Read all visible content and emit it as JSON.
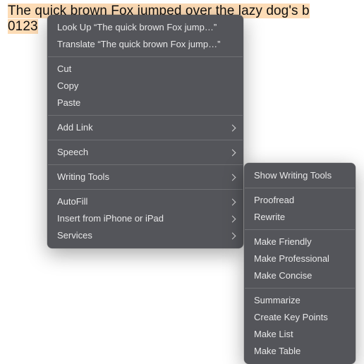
{
  "text": {
    "line1": "The quick brown Fox jumped over the lazy dog's b",
    "line2": "0123"
  },
  "menu_main": {
    "lookup": "Look Up “The quick brown Fox jump…”",
    "translate": "Translate “The quick brown Fox jump…”",
    "cut": "Cut",
    "copy": "Copy",
    "paste": "Paste",
    "add_link": "Add Link",
    "speech": "Speech",
    "writing_tools": "Writing Tools",
    "autofill": "AutoFill",
    "insert_from": "Insert from iPhone or iPad",
    "services": "Services"
  },
  "menu_writing_tools": {
    "show": "Show Writing Tools",
    "proofread": "Proofread",
    "rewrite": "Rewrite",
    "make_friendly": "Make Friendly",
    "make_professional": "Make Professional",
    "make_concise": "Make Concise",
    "summarize": "Summarize",
    "create_key_points": "Create Key Points",
    "make_list": "Make List",
    "make_table": "Make Table"
  }
}
